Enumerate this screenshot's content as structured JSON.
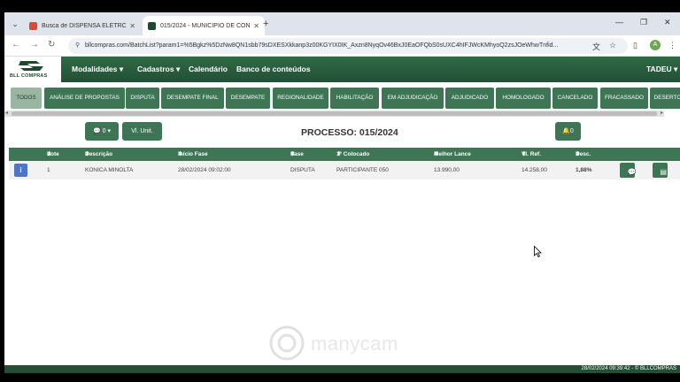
{
  "browser": {
    "tabs": [
      {
        "title": "Busca de DISPENSA ELETRÔNICA",
        "favicon_color": "#d84a3a",
        "active": false
      },
      {
        "title": "015/2024 - MUNICIPIO DE CON",
        "favicon_color": "#1c4a30",
        "active": true
      }
    ],
    "url": "bllcompras.com/BatchList?param1=%5Bgkz%5DzNw8QN1sbb79sDXESXkkanp3z00KGYIX0IK_Axzn8NyqOv46BxJ0EaOFQbS0sUXC4hIFJWcKMhyoQ2zsJOeWhwTnfid...",
    "profile_initial": "A"
  },
  "header": {
    "logo_text": "BLL COMPRAS",
    "nav": [
      "Modalidades",
      "Cadastros",
      "Calendário",
      "Banco de conteúdos"
    ],
    "user": "TADEU"
  },
  "status_tabs": [
    "TODOS",
    "ANÁLISE DE PROPOSTAS",
    "DISPUTA",
    "DESEMPATE FINAL",
    "DESEMPATE",
    "REGIONALIDADE",
    "HABILITAÇÃO",
    "EM ADJUDICAÇÃO",
    "ADJUDICADO",
    "HOMOLOGADO",
    "CANCELADO",
    "FRACASSADO",
    "DESERTO"
  ],
  "toolbar": {
    "chat_count": "0",
    "vl_unit_label": "Vl. Unit.",
    "process_title": "PROCESSO: 015/2024",
    "bell_count": "0"
  },
  "table": {
    "columns": [
      "Lote",
      "Descrição",
      "Início Fase",
      "Fase",
      "1º Colocado",
      "Melhor Lance",
      "Vl. Ref.",
      "Desc."
    ],
    "rows": [
      {
        "lote": "1",
        "descricao": "KONICA MINOLTA",
        "inicio_fase": "28/02/2024 09:02:00",
        "fase": "DISPUTA",
        "primeiro_colocado": "PARTICIPANTE 050",
        "melhor_lance": "13.990,00",
        "vl_ref": "14.258,00",
        "desc": "1,88%"
      }
    ]
  },
  "watermark": "manycam",
  "footer": "28/02/2024 09:39:42 - © BLLCOMPRAS"
}
